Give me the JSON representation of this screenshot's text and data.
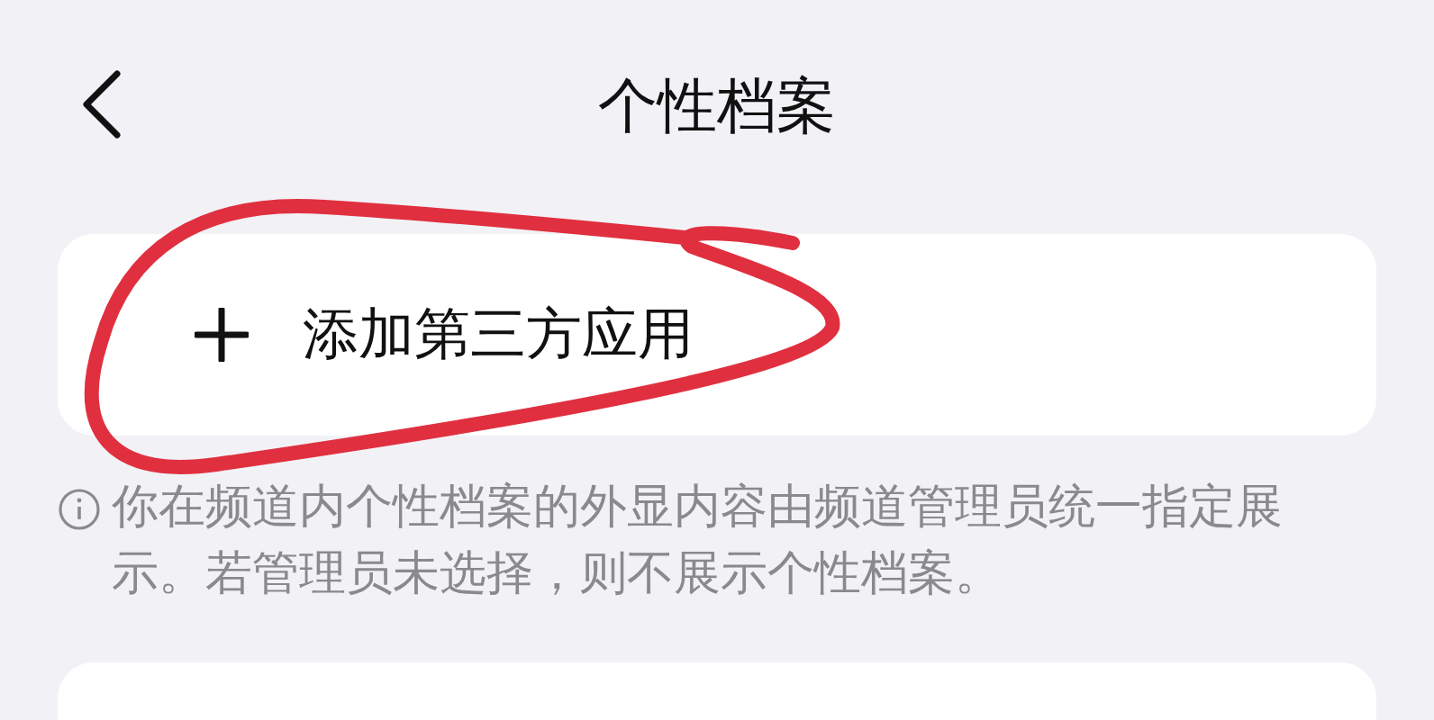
{
  "header": {
    "title": "个性档案"
  },
  "actions": [
    {
      "label": "添加第三方应用"
    }
  ],
  "note": {
    "text": "你在频道内个性档案的外显内容由频道管理员统一指定展示。若管理员未选择，则不展示个性档案。"
  }
}
